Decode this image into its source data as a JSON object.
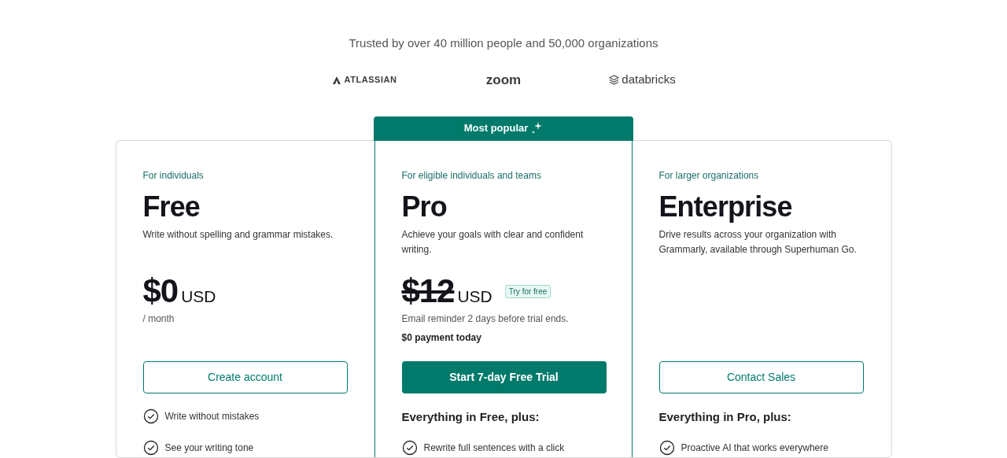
{
  "tagline": "Trusted by over 40 million people and 50,000 organizations",
  "logos": [
    {
      "kind": "atlassian",
      "text": "ATLASSIAN"
    },
    {
      "kind": "zoom",
      "text": "zoom"
    },
    {
      "kind": "databricks",
      "text": "databricks"
    }
  ],
  "plans": [
    {
      "audience": "For individuals",
      "name": "Free",
      "description": "Write without spelling and grammar mistakes.",
      "price": "$0",
      "currency": "USD",
      "struck": false,
      "period": "/ month",
      "cta": "Create account",
      "primary": false,
      "features": [
        "Write without mistakes",
        "See your writing tone"
      ]
    },
    {
      "banner": "Most popular",
      "audience": "For eligible individuals and teams",
      "name": "Pro",
      "description": "Achieve your goals with clear and confident writing.",
      "price": "$12",
      "currency": "USD",
      "struck": true,
      "badge": "Try for free",
      "note": "Email reminder 2 days before trial ends.",
      "note_bold": "$0 payment today",
      "cta": "Start 7-day Free Trial",
      "primary": true,
      "features_heading": "Everything in Free, plus:",
      "features": [
        "Rewrite full sentences with a click"
      ]
    },
    {
      "audience": "For larger organizations",
      "name": "Enterprise",
      "description": "Drive results across your organization with Grammarly, available through Superhuman Go.",
      "cta": "Contact Sales",
      "primary": false,
      "features_heading": "Everything in Pro, plus:",
      "features": [
        "Proactive AI that works everywhere"
      ]
    }
  ]
}
